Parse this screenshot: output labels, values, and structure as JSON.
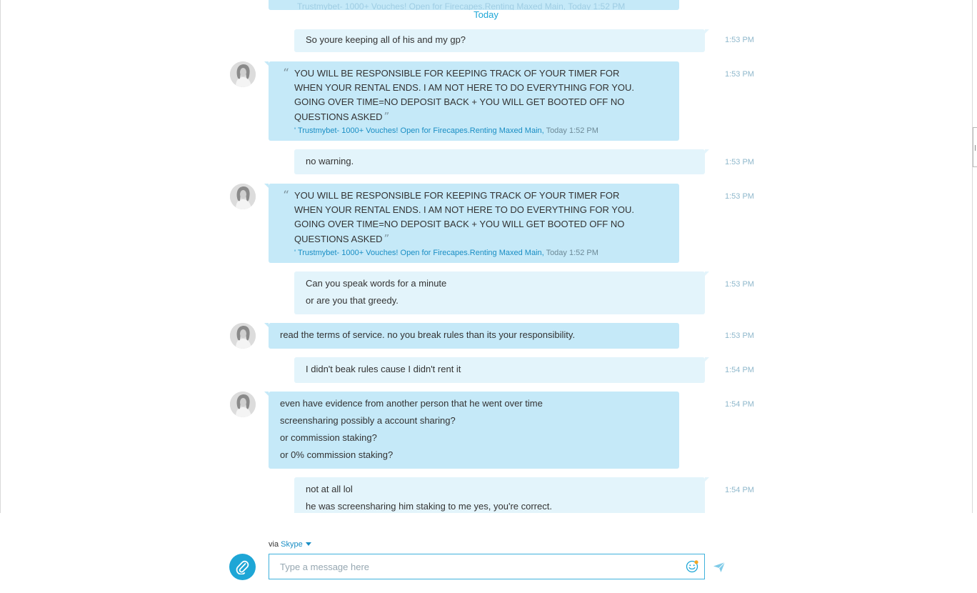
{
  "history": {
    "previous_peek_text": "Trustmybet- 1000+ Vouches! Open for Firecapes.Renting Maxed Main, Today 1:52 PM",
    "day_label": "Today"
  },
  "messages": [
    {
      "lines": [
        "So youre keeping all of his and my gp?"
      ],
      "time": "1:53 PM"
    },
    {
      "quote": {
        "text": "YOU WILL BE RESPONSIBLE FOR KEEPING TRACK OF YOUR TIMER FOR WHEN YOUR RENTAL ENDS. I AM NOT HERE TO DO EVERYTHING FOR YOU. GOING OVER TIME=NO DEPOSIT BACK + YOU WILL GET BOOTED OFF NO QUESTIONS ASKED",
        "author": "' Trustmybet- 1000+ Vouches! Open for Firecapes.Renting Maxed Main,",
        "time": "Today 1:52 PM"
      },
      "time": "1:53 PM"
    },
    {
      "lines": [
        "no warning."
      ],
      "time": "1:53 PM"
    },
    {
      "quote": {
        "text": "YOU WILL BE RESPONSIBLE FOR KEEPING TRACK OF YOUR TIMER FOR WHEN YOUR RENTAL ENDS. I AM NOT HERE TO DO EVERYTHING FOR YOU. GOING OVER TIME=NO DEPOSIT BACK + YOU WILL GET BOOTED OFF NO QUESTIONS ASKED",
        "author": "' Trustmybet- 1000+ Vouches! Open for Firecapes.Renting Maxed Main,",
        "time": "Today 1:52 PM"
      },
      "time": "1:53 PM"
    },
    {
      "lines": [
        "Can you speak words for a minute",
        "or are you that greedy."
      ],
      "time": "1:53 PM"
    },
    {
      "lines": [
        "read the terms of service. no you break rules than its your responsibility."
      ],
      "time": "1:53 PM"
    },
    {
      "lines": [
        "I didn't beak rules cause I didn't rent it"
      ],
      "time": "1:54 PM"
    },
    {
      "lines": [
        "even have evidence from another person that he went over time",
        "screensharing possibly a account sharing?",
        "or commission staking?",
        "or 0% commission staking?"
      ],
      "time": "1:54 PM"
    },
    {
      "lines": [
        "not at all lol",
        "he was screensharing him staking to me yes, you're correct."
      ],
      "time": "1:54 PM"
    }
  ],
  "composer": {
    "via_label": "via",
    "service_name": "Skype",
    "placeholder": "Type a message here"
  },
  "colors": {
    "accent": "#1ea6d6",
    "my_bubble": "#e3f4fb",
    "their_bubble": "#c5e9f8",
    "timestamp": "#8fb8cc"
  },
  "icons": {
    "attach": "paperclip-icon",
    "emoji": "smiley-icon",
    "send": "paper-plane-icon"
  }
}
